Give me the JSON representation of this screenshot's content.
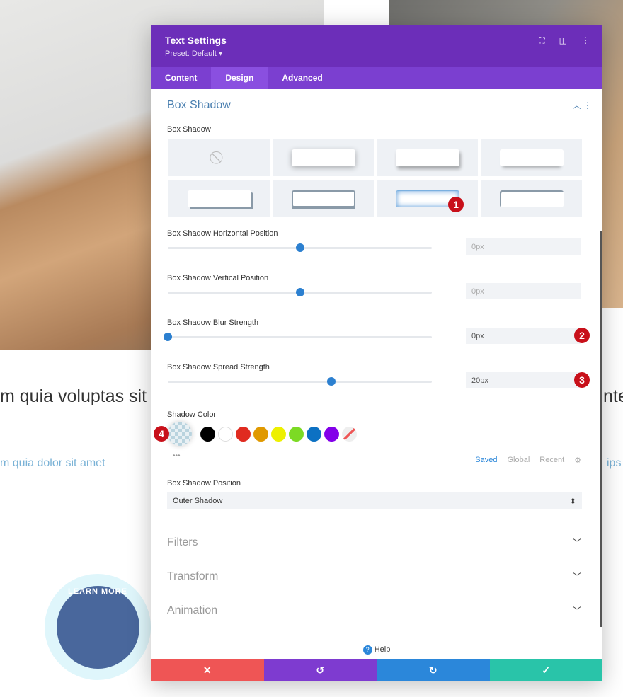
{
  "background": {
    "heading_left": "m quia voluptas sit",
    "heading_right": "nte",
    "link_left": "m quia dolor sit amet",
    "link_right": "ips",
    "button": "LEARN MORE"
  },
  "modal": {
    "title": "Text Settings",
    "preset": "Preset: Default ▾",
    "tabs": [
      {
        "label": "Content"
      },
      {
        "label": "Design",
        "active": true
      },
      {
        "label": "Advanced"
      }
    ],
    "section": "Box Shadow",
    "box_shadow_label": "Box Shadow",
    "presets_selected": 6,
    "sliders": [
      {
        "label": "Box Shadow Horizontal Position",
        "value": "0px",
        "level": 0.5,
        "placeholder": true
      },
      {
        "label": "Box Shadow Vertical Position",
        "value": "0px",
        "level": 0.5,
        "placeholder": true
      },
      {
        "label": "Box Shadow Blur Strength",
        "value": "0px",
        "level": 0,
        "placeholder": false
      },
      {
        "label": "Box Shadow Spread Strength",
        "value": "20px",
        "level": 0.62,
        "placeholder": false
      }
    ],
    "shadow_color_label": "Shadow Color",
    "swatches": [
      "#000000",
      "#ffffff",
      "#e02b20",
      "#e09900",
      "#edf000",
      "#7cda24",
      "#0c71c3",
      "#8300e9"
    ],
    "color_tabs": [
      "Saved",
      "Global",
      "Recent"
    ],
    "position_label": "Box Shadow Position",
    "position_value": "Outer Shadow",
    "collapsed": [
      "Filters",
      "Transform",
      "Animation"
    ],
    "help": "Help",
    "more": "•••",
    "badges": [
      "1",
      "2",
      "3",
      "4"
    ]
  },
  "colors": {
    "header": "#6c2eb9",
    "tabs": "#7b3fd0",
    "cancel": "#ef5555",
    "undo": "#7e3bd0",
    "redo": "#2b87da",
    "save": "#29c4a9"
  }
}
